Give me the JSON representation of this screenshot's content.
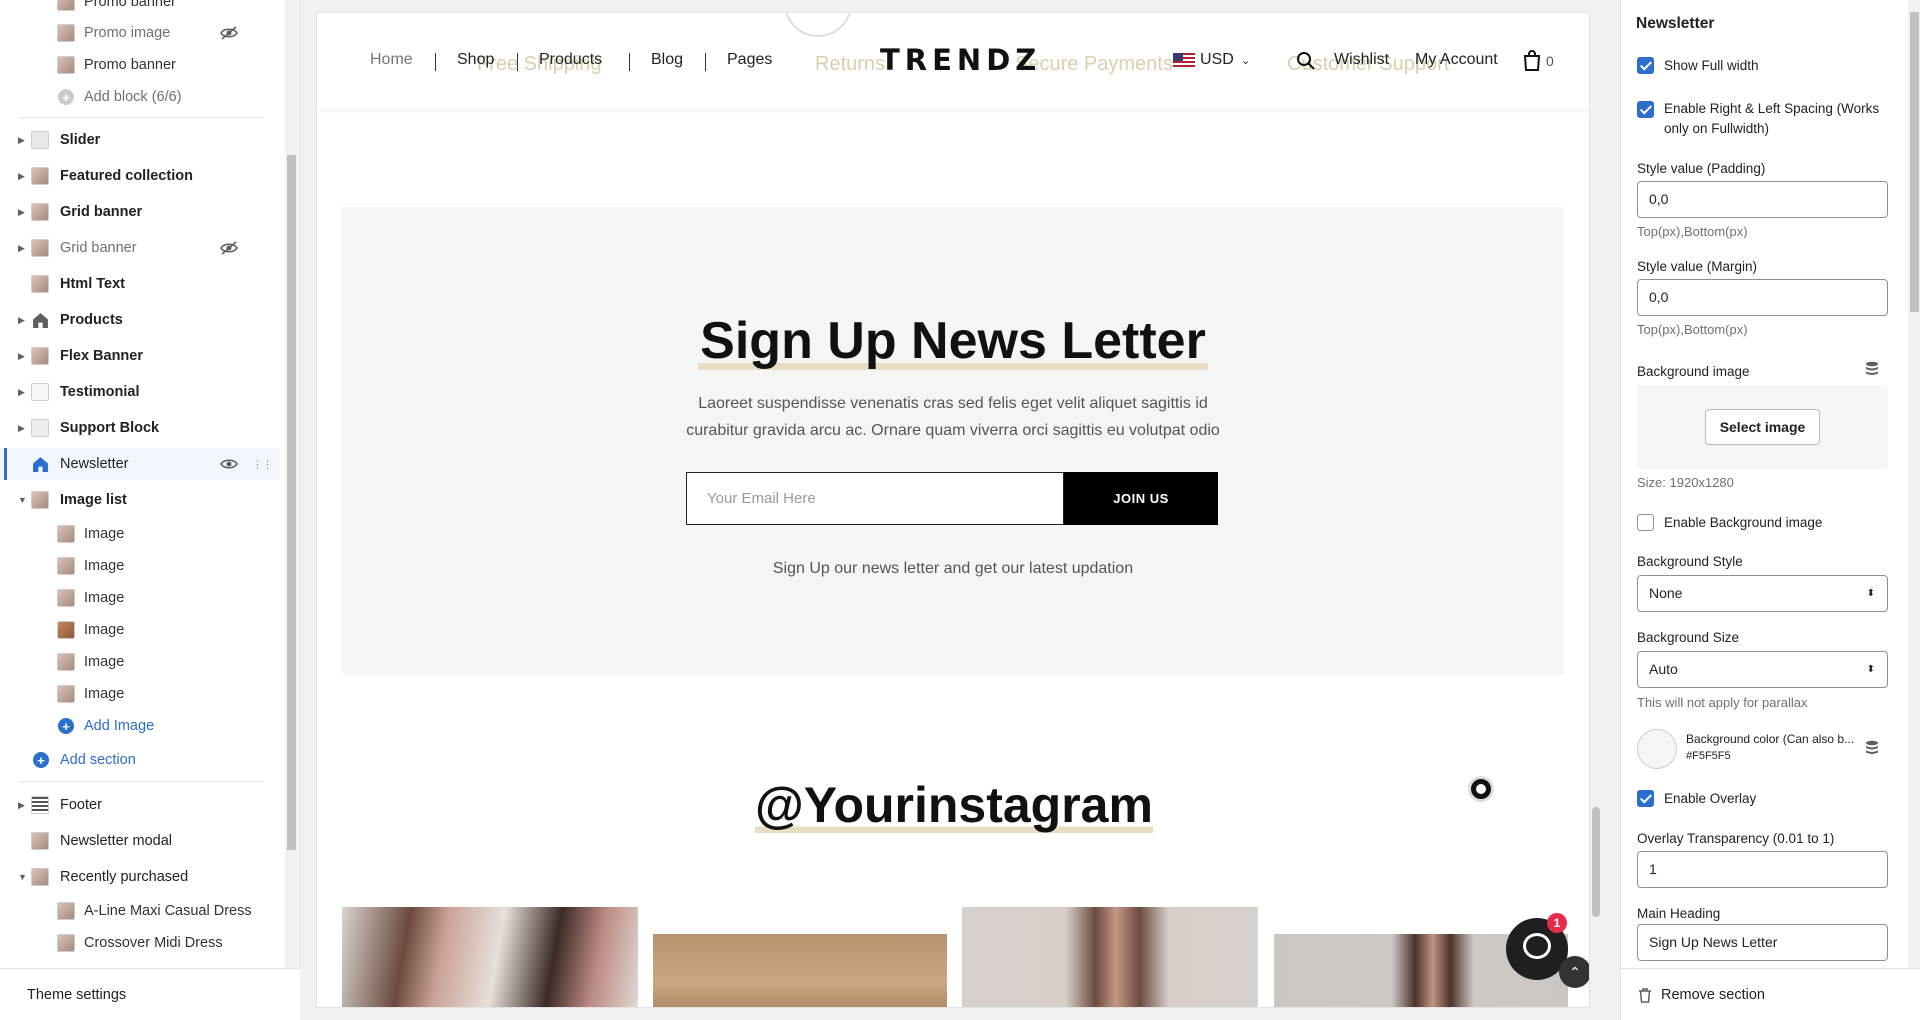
{
  "sidebar": {
    "items": [
      {
        "label": "Promo banner",
        "kind": "child",
        "hidden": false
      },
      {
        "label": "Promo image",
        "kind": "child",
        "hidden": true
      },
      {
        "label": "Promo banner",
        "kind": "child",
        "hidden": false
      },
      {
        "label": "Add block (6/6)",
        "kind": "add-disabled"
      },
      {
        "label": "Slider",
        "kind": "top"
      },
      {
        "label": "Featured collection",
        "kind": "top"
      },
      {
        "label": "Grid banner",
        "kind": "top"
      },
      {
        "label": "Grid banner",
        "kind": "top",
        "hidden": true
      },
      {
        "label": "Html Text",
        "kind": "top"
      },
      {
        "label": "Products",
        "kind": "top"
      },
      {
        "label": "Flex Banner",
        "kind": "top"
      },
      {
        "label": "Testimonial",
        "kind": "top"
      },
      {
        "label": "Support Block",
        "kind": "top"
      },
      {
        "label": "Newsletter",
        "kind": "top",
        "active": true
      },
      {
        "label": "Image list",
        "kind": "top",
        "expanded": true
      },
      {
        "label": "Image",
        "kind": "child"
      },
      {
        "label": "Image",
        "kind": "child"
      },
      {
        "label": "Image",
        "kind": "child"
      },
      {
        "label": "Image",
        "kind": "child"
      },
      {
        "label": "Image",
        "kind": "child"
      },
      {
        "label": "Image",
        "kind": "child"
      },
      {
        "label": "Add Image",
        "kind": "add"
      },
      {
        "label": "Add section",
        "kind": "add-section"
      },
      {
        "label": "Footer",
        "kind": "top"
      },
      {
        "label": "Newsletter modal",
        "kind": "top"
      },
      {
        "label": "Recently purchased",
        "kind": "top",
        "expanded": true
      },
      {
        "label": "A-Line Maxi Casual Dress",
        "kind": "child"
      },
      {
        "label": "Crossover Midi Dress",
        "kind": "child"
      }
    ],
    "theme_settings": "Theme settings"
  },
  "preview": {
    "ghost_texts": [
      "Free Shipping",
      "Returns",
      "Secure Payments",
      "Customer Support"
    ],
    "nav": [
      "Home",
      "Shop",
      "Products",
      "Blog",
      "Pages"
    ],
    "logo": "TRENDZ",
    "currency": "USD",
    "wishlist": "Wishlist",
    "account": "My Account",
    "cart_count": "0",
    "newsletter": {
      "title": "Sign Up News Letter",
      "description": "Laoreet suspendisse venenatis cras sed felis eget velit aliquet sagittis id curabitur gravida arcu ac. Ornare quam viverra orci sagittis eu volutpat odio",
      "email_placeholder": "Your Email Here",
      "button": "JOIN US",
      "subtext": "Sign Up our news letter and get our latest updation"
    },
    "instagram_title": "@Yourinstagram",
    "chat_badge": "1"
  },
  "settings": {
    "title": "Newsletter",
    "show_full_width": "Show Full width",
    "enable_spacing": "Enable Right & Left Spacing (Works only on Fullwidth)",
    "padding_label": "Style value (Padding)",
    "padding_value": "0,0",
    "padding_help": "Top(px),Bottom(px)",
    "margin_label": "Style value (Margin)",
    "margin_value": "0,0",
    "margin_help": "Top(px),Bottom(px)",
    "bg_image_label": "Background image",
    "select_image": "Select image",
    "size_help": "Size: 1920x1280",
    "enable_bg_image": "Enable Background image",
    "bg_style_label": "Background Style",
    "bg_style_value": "None",
    "bg_size_label": "Background Size",
    "bg_size_value": "Auto",
    "parallax_help": "This will not apply for parallax",
    "bg_color_label": "Background color (Can also b...",
    "bg_color_value": "#F5F5F5",
    "enable_overlay": "Enable Overlay",
    "overlay_label": "Overlay Transparency (0.01 to 1)",
    "overlay_value": "1",
    "main_heading_label": "Main Heading",
    "main_heading_value": "Sign Up News Letter",
    "remove_section": "Remove section"
  },
  "colors": {
    "accent": "#2c6ecb",
    "newsletter_bg": "#F5F5F5",
    "join_button": "#000000",
    "underline": "#e8dcc3"
  }
}
